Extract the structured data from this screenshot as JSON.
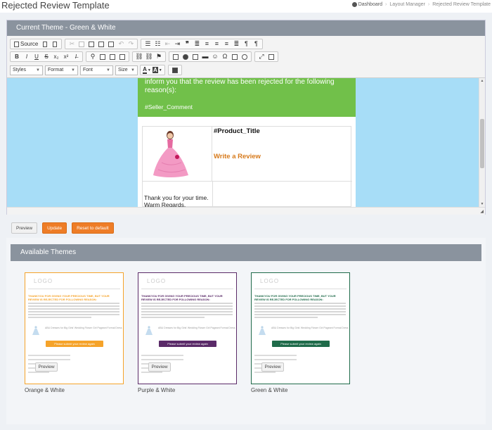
{
  "page": {
    "title": "Rejected Review Template"
  },
  "breadcrumb": [
    "Dashboard",
    "Layout Manager",
    "Rejected Review Template"
  ],
  "editor": {
    "heading": "Current Theme - Green & White",
    "toolbar": {
      "source_label": "Source",
      "combos": [
        "Styles",
        "Format",
        "Font",
        "Size"
      ]
    },
    "content": {
      "message": "inform you that the review has been rejected for the following reason(s):",
      "seller_comment": "#Seller_Comment",
      "product_title": "#Product_Title",
      "write_review": "Write a Review",
      "thanks_line1": "Thank you for your time.",
      "thanks_line2": "Warm Regards,"
    },
    "colors": {
      "canvas_bg": "#a7ddf7",
      "green_block": "#71c04a",
      "link_orange": "#d77a1b"
    }
  },
  "actions": {
    "preview": "Preview",
    "update": "Update",
    "reset": "Reset to default"
  },
  "themes": {
    "heading": "Available Themes",
    "items": [
      {
        "name": "Orange & White",
        "accent": "#f5a32a",
        "cta": "Please submit your review again",
        "preview": "Preview",
        "logo": "LOGO",
        "heading_text": "THANKYOU FOR GIVING YOUR PRECIOUS TIME, BUT YOUR REVIEW IS REJECTED FOR FOLLOWING REASON:",
        "product": "ABU Dresses for Big Girls' Wedding Flower Girl Pageant Formal Dress"
      },
      {
        "name": "Purple & White",
        "accent": "#5a2a68",
        "cta": "Please submit your review again",
        "preview": "Preview",
        "logo": "LOGO",
        "heading_text": "THANKYOU FOR GIVING YOUR PRECIOUS TIME, BUT YOUR REVIEW IS REJECTED FOR FOLLOWING REASON:",
        "product": "ABU Dresses for Big Girls' Wedding Flower Girl Pageant Formal Dress"
      },
      {
        "name": "Green & White",
        "accent": "#1f6b4a",
        "cta": "Please submit your review again",
        "preview": "Preview",
        "logo": "LOGO",
        "heading_text": "THANKYOU FOR GIVING YOUR PRECIOUS TIME, BUT YOUR REVIEW IS REJECTED FOR FOLLOWING REASON:",
        "product": "ABU Dresses for Big Girls' Wedding Flower Girl Pageant Formal Dress"
      }
    ]
  }
}
